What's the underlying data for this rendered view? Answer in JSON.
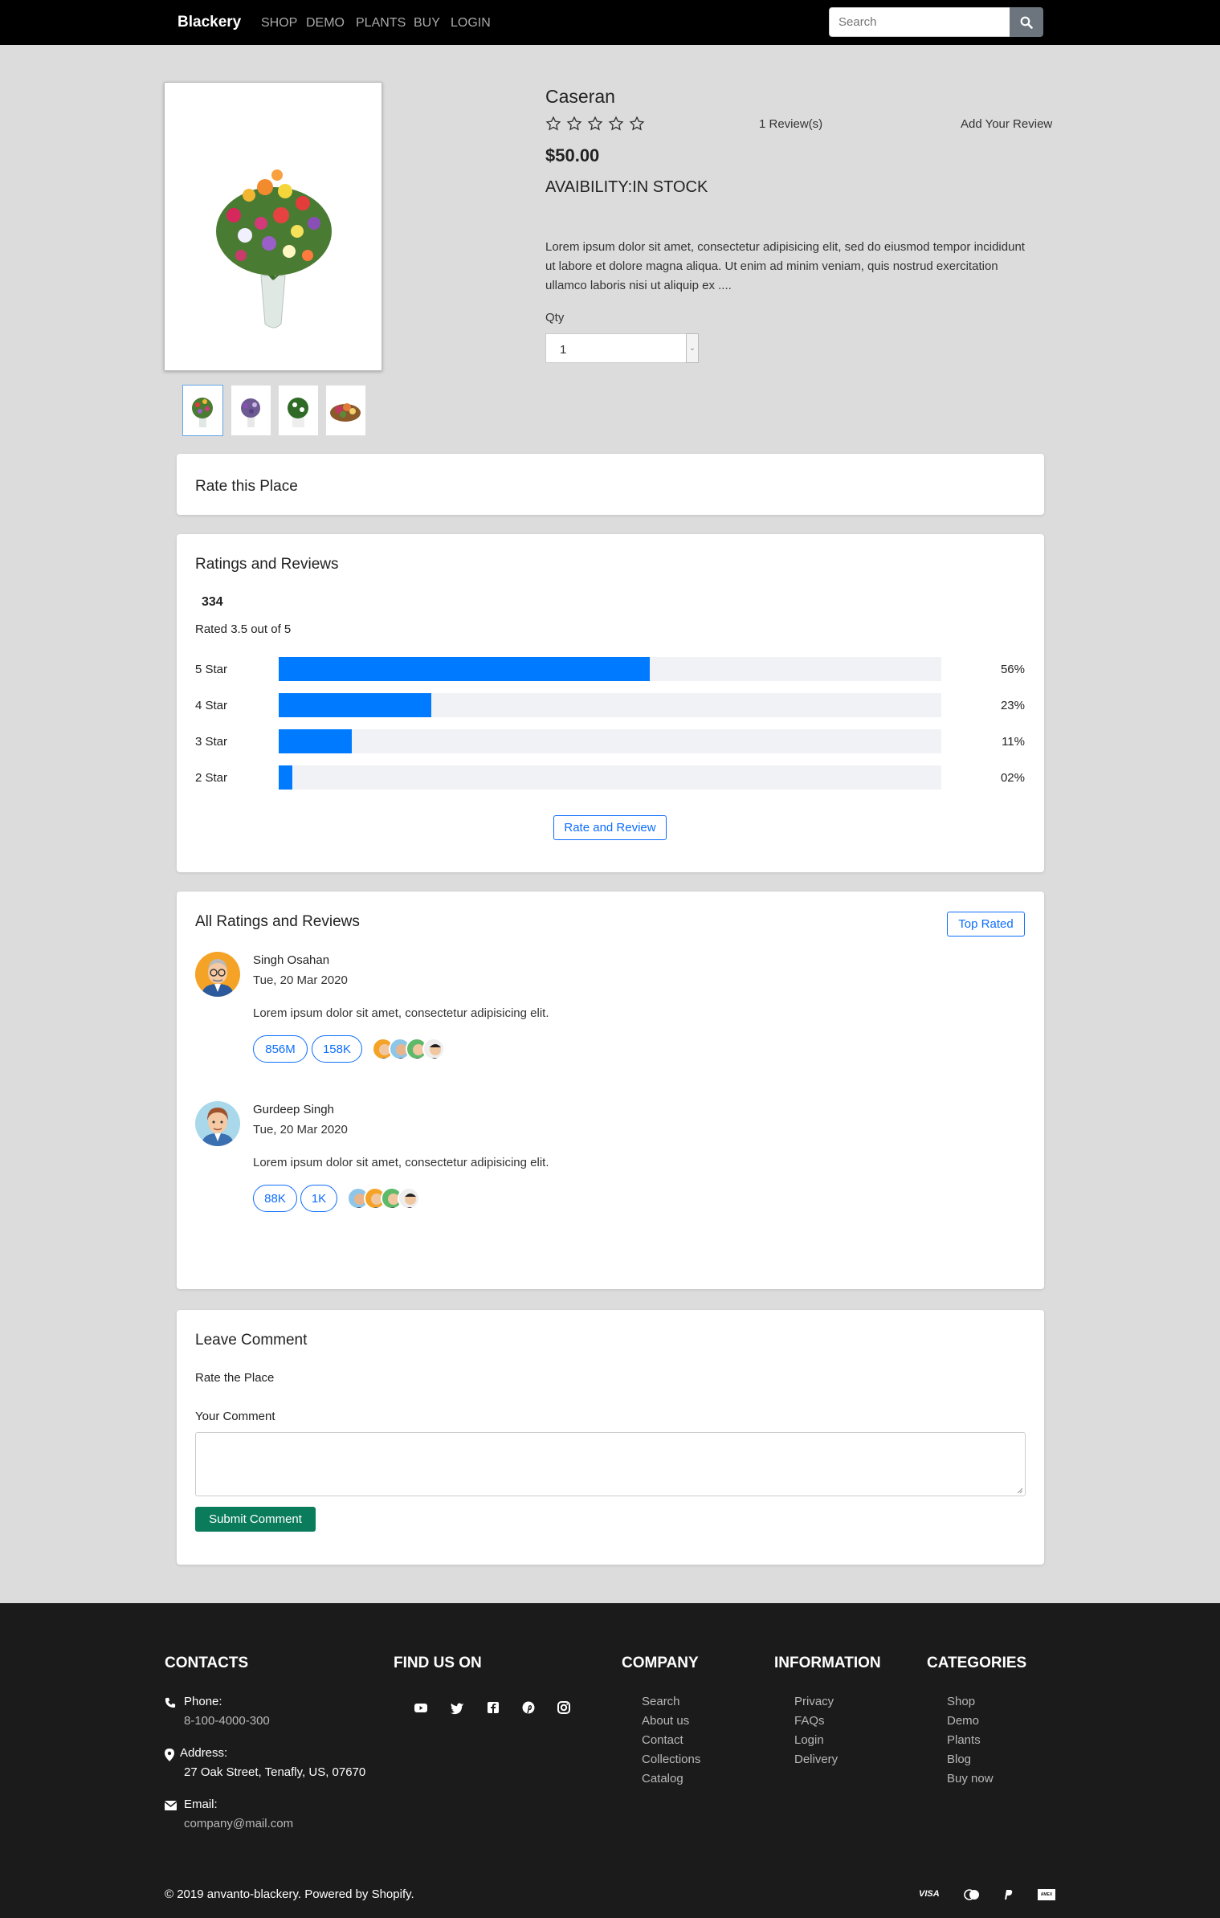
{
  "nav": {
    "brand": "Blackery",
    "links": [
      "SHOP",
      "DEMO",
      "PLANTS",
      "BUY",
      "LOGIN"
    ],
    "search_placeholder": "Search"
  },
  "product": {
    "title": "Caseran",
    "rating_stars": 0,
    "review_count": "1 Review(s)",
    "add_review": "Add Your Review",
    "price": "$50.00",
    "availability": "AVAIBILITY:IN STOCK",
    "description": "Lorem ipsum dolor sit amet, consectetur adipisicing elit, sed do eiusmod tempor incididunt ut labore et dolore magna aliqua. Ut enim ad minim veniam, quis nostrud exercitation ullamco laboris nisi ut aliquip ex ....",
    "qty_label": "Qty",
    "qty_value": "1"
  },
  "rate_card": {
    "title": "Rate this Place"
  },
  "ratings_card": {
    "title": "Ratings and Reviews",
    "total": "334",
    "summary": "Rated 3.5 out of 5",
    "bars": [
      {
        "label": "5 Star",
        "percent": 56,
        "percent_label": "56%"
      },
      {
        "label": "4 Star",
        "percent": 23,
        "percent_label": "23%"
      },
      {
        "label": "3 Star",
        "percent": 11,
        "percent_label": "11%"
      },
      {
        "label": "2 Star",
        "percent": 2,
        "percent_label": "02%"
      }
    ],
    "button": "Rate and Review"
  },
  "reviews_card": {
    "title": "All Ratings and Reviews",
    "top_button": "Top Rated",
    "reviews": [
      {
        "name": "Singh Osahan",
        "date": "Tue, 20 Mar 2020",
        "text": "Lorem ipsum dolor sit amet, consectetur adipisicing elit.",
        "likes": "856M",
        "dislikes": "158K"
      },
      {
        "name": "Gurdeep Singh",
        "date": "Tue, 20 Mar 2020",
        "text": "Lorem ipsum dolor sit amet, consectetur adipisicing elit.",
        "likes": "88K",
        "dislikes": "1K"
      }
    ]
  },
  "comment_card": {
    "title": "Leave Comment",
    "rate_label": "Rate the Place",
    "comment_label": "Your Comment",
    "submit": "Submit Comment"
  },
  "footer": {
    "contacts_title": "CONTACTS",
    "phone_label": "Phone:",
    "phone": "8-100-4000-300",
    "address_label": "Address:",
    "address": "27 Oak Street, Tenafly, US, 07670",
    "email_label": "Email:",
    "email": "company@mail.com",
    "find_title": "FIND US ON",
    "social": [
      "youtube-icon",
      "twitter-icon",
      "facebook-icon",
      "pinterest-icon",
      "instagram-icon"
    ],
    "company_title": "COMPANY",
    "company_links": [
      "Search",
      "About us",
      "Contact",
      "Collections",
      "Catalog"
    ],
    "info_title": "INFORMATION",
    "info_links": [
      "Privacy",
      "FAQs",
      "Login",
      "Delivery"
    ],
    "cat_title": "CATEGORIES",
    "cat_links": [
      "Shop",
      "Demo",
      "Plants",
      "Blog",
      "Buy now"
    ],
    "copyright": "© 2019 anvanto-blackery. Powered by Shopify.",
    "payment_visa": "VISA",
    "payment_amex": "AMEX"
  },
  "colors": {
    "accent": "#007bff",
    "submit": "#0a7c5c",
    "nav": "#000000",
    "footer": "#1b1b1b"
  }
}
